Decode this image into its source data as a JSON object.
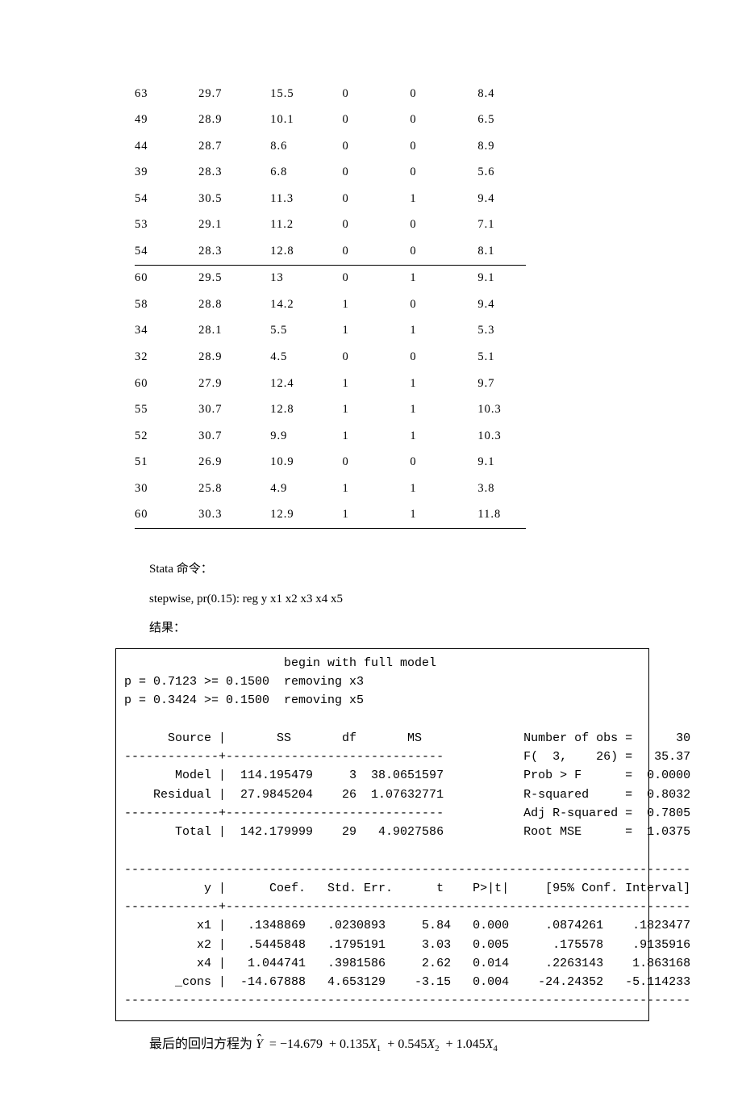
{
  "table": {
    "rows": [
      [
        "63",
        "29.7",
        "15.5",
        "0",
        "0",
        "8.4"
      ],
      [
        "49",
        "28.9",
        "10.1",
        "0",
        "0",
        "6.5"
      ],
      [
        "44",
        "28.7",
        "8.6",
        "0",
        "0",
        "8.9"
      ],
      [
        "39",
        "28.3",
        "6.8",
        "0",
        "0",
        "5.6"
      ],
      [
        "54",
        "30.5",
        "11.3",
        "0",
        "1",
        "9.4"
      ],
      [
        "53",
        "29.1",
        "11.2",
        "0",
        "0",
        "7.1"
      ],
      [
        "54",
        "28.3",
        "12.8",
        "0",
        "0",
        "8.1"
      ],
      [
        "60",
        "29.5",
        "13",
        "0",
        "1",
        "9.1"
      ],
      [
        "58",
        "28.8",
        "14.2",
        "1",
        "0",
        "9.4"
      ],
      [
        "34",
        "28.1",
        "5.5",
        "1",
        "1",
        "5.3"
      ],
      [
        "32",
        "28.9",
        "4.5",
        "0",
        "0",
        "5.1"
      ],
      [
        "60",
        "27.9",
        "12.4",
        "1",
        "1",
        "9.7"
      ],
      [
        "55",
        "30.7",
        "12.8",
        "1",
        "1",
        "10.3"
      ],
      [
        "52",
        "30.7",
        "9.9",
        "1",
        "1",
        "10.3"
      ],
      [
        "51",
        "26.9",
        "10.9",
        "0",
        "0",
        "9.1"
      ],
      [
        "30",
        "25.8",
        "4.9",
        "1",
        "1",
        "3.8"
      ],
      [
        "60",
        "30.3",
        "12.9",
        "1",
        "1",
        "11.8"
      ]
    ],
    "midline_after": 7
  },
  "text": {
    "cmd_label": "Stata 命令：",
    "cmd": "stepwise, pr(0.15): reg y x1 x2 x3 x4 x5",
    "result_label": "结果："
  },
  "output": "                      begin with full model\np = 0.7123 >= 0.1500  removing x3\np = 0.3424 >= 0.1500  removing x5\n\n      Source |       SS       df       MS              Number of obs =      30\n-------------+------------------------------           F(  3,    26) =   35.37\n       Model |  114.195479     3  38.0651597           Prob > F      =  0.0000\n    Residual |  27.9845204    26  1.07632771           R-squared     =  0.8032\n-------------+------------------------------           Adj R-squared =  0.7805\n       Total |  142.179999    29   4.9027586           Root MSE      =  1.0375\n\n------------------------------------------------------------------------------\n           y |      Coef.   Std. Err.      t    P>|t|     [95% Conf. Interval]\n-------------+----------------------------------------------------------------\n          x1 |   .1348869   .0230893     5.84   0.000     .0874261    .1823477\n          x2 |   .5445848   .1795191     3.03   0.005      .175578    .9135916\n          x4 |   1.044741   .3981586     2.62   0.014     .2263143    1.863168\n       _cons |  -14.67888   4.653129    -3.15   0.004    -24.24352   -5.114233\n------------------------------------------------------------------------------",
  "equation": {
    "prefix": "最后的回归方程为",
    "params": {
      "intercept": "−14.679",
      "b1": "0.135",
      "b2": "0.545",
      "b4": "1.045"
    }
  }
}
